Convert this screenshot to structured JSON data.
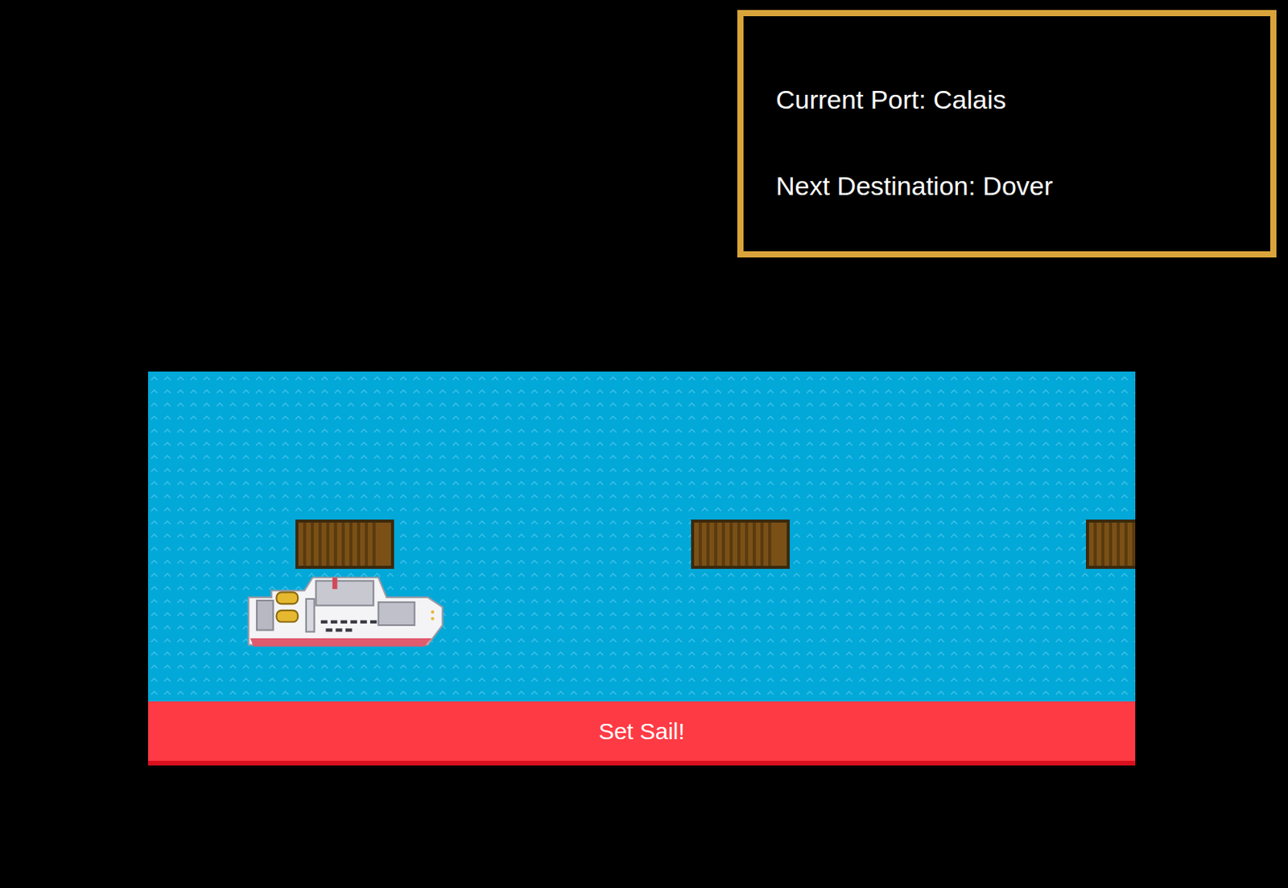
{
  "info_panel": {
    "current_port": "Current Port: Calais",
    "next_destination": "Next Destination: Dover"
  },
  "button": {
    "label": "Set Sail!"
  }
}
